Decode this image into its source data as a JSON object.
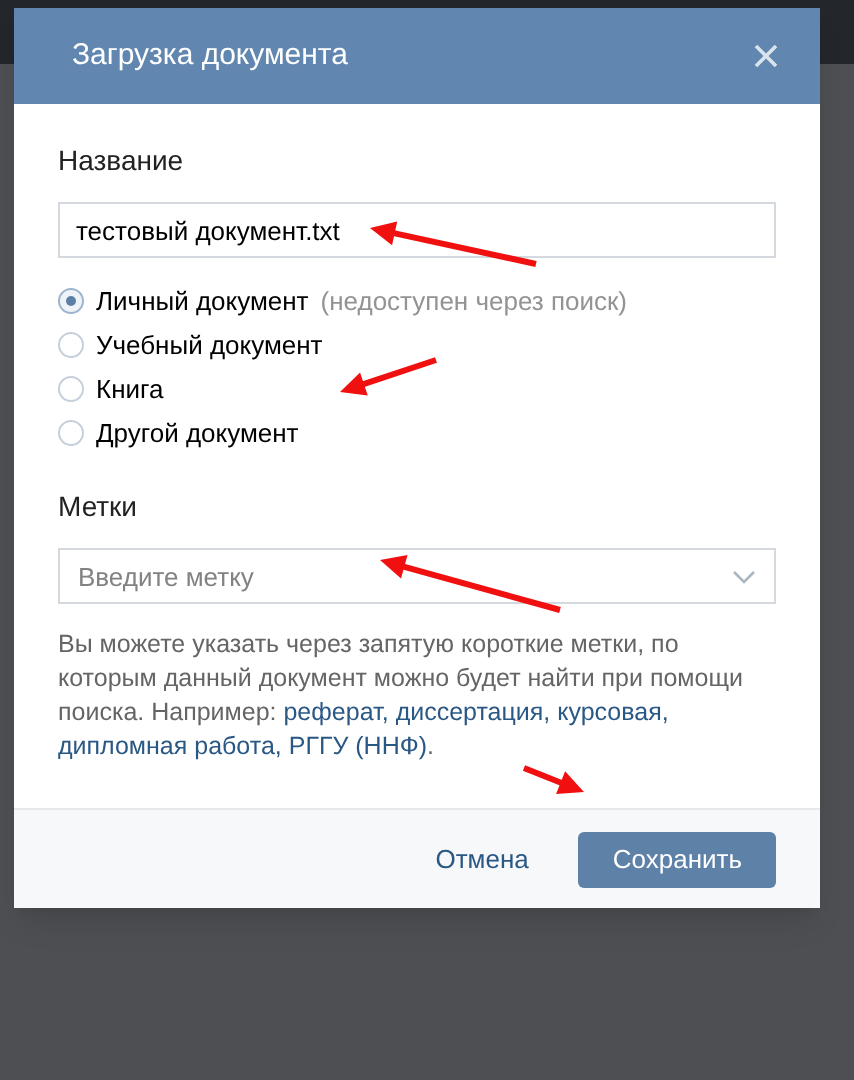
{
  "dialog": {
    "title": "Загрузка документа",
    "name_label": "Название",
    "name_value": "тестовый документ.txt",
    "types": [
      {
        "label": "Личный документ",
        "note": "(недоступен через поиск)",
        "selected": true
      },
      {
        "label": "Учебный документ",
        "selected": false
      },
      {
        "label": "Книга",
        "selected": false
      },
      {
        "label": "Другой документ",
        "selected": false
      }
    ],
    "tags_label": "Метки",
    "tags_placeholder": "Введите метку",
    "help": {
      "text": "Вы можете указать через запятую короткие метки, по которым данный документ можно будет найти при помощи поиска. Например:",
      "examples": [
        "реферат,",
        "диссертация,",
        "курсовая,",
        "дипломная работа,",
        "РГГУ (ННФ)"
      ],
      "ending": "."
    },
    "buttons": [
      {
        "label": "Отмена",
        "kind": "link"
      },
      {
        "label": "Сохранить",
        "kind": "primary"
      }
    ]
  }
}
